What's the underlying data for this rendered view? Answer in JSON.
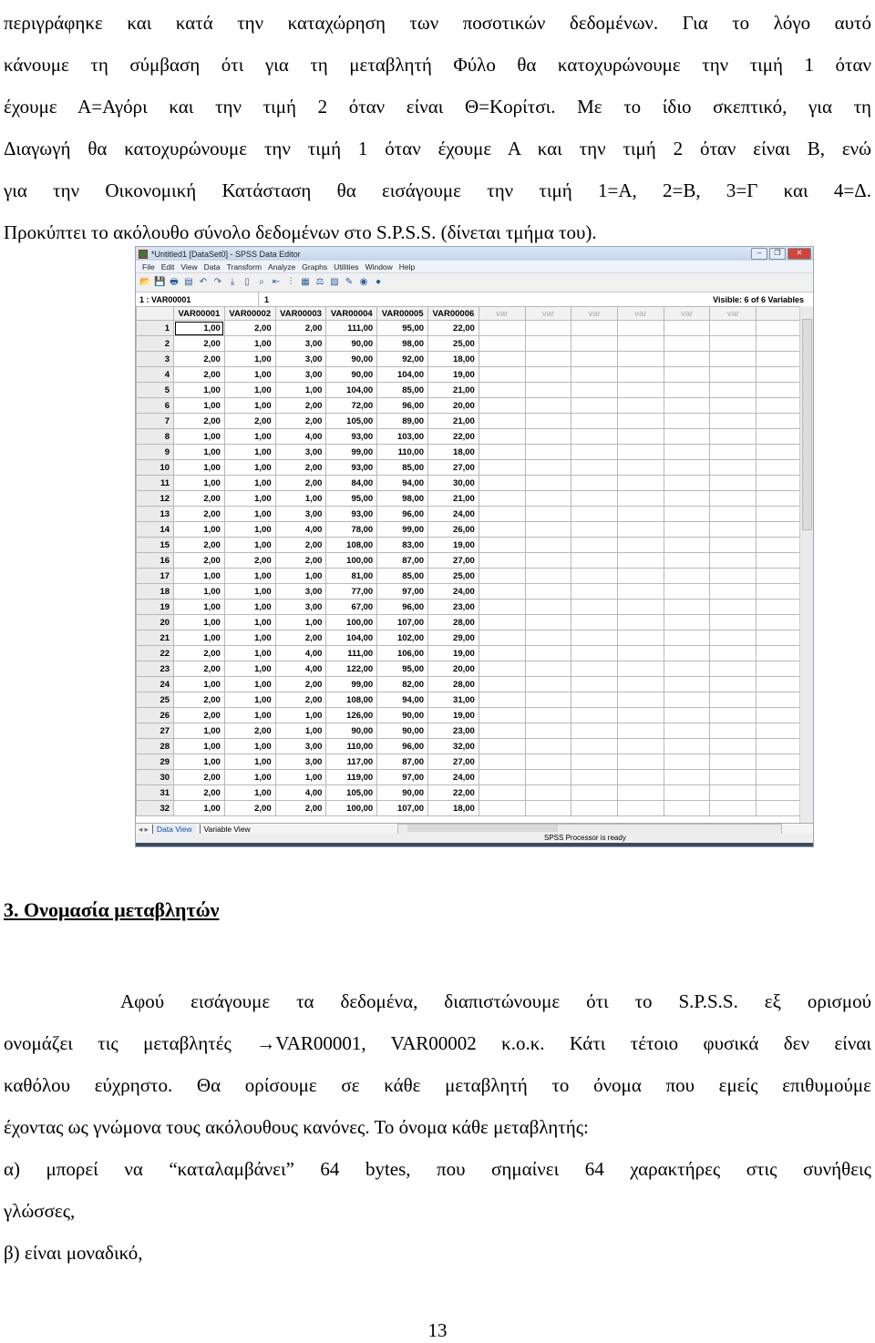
{
  "document": {
    "top_paragraph_lines": [
      "περιγράφηκε και κατά την καταχώρηση των ποσοτικών δεδομένων. Για το λόγο αυτό",
      "κάνουμε τη σύμβαση ότι για τη μεταβλητή Φύλο θα κατοχυρώνουμε την τιμή 1 όταν",
      "έχουμε Α=Αγόρι και την τιμή 2 όταν είναι Θ=Κορίτσι. Με το ίδιο σκεπτικό, για τη",
      "Διαγωγή θα κατοχυρώνουμε την τιμή 1 όταν έχουμε Α και την τιμή 2 όταν είναι Β, ενώ",
      "για την Οικονομική Κατάσταση θα εισάγουμε την τιμή 1=Α, 2=Β, 3=Γ και 4=Δ.",
      "Προκύπτει το ακόλουθο σύνολο  δεδομένων στο S.P.S.S. (δίνεται τμήμα του)."
    ],
    "heading": "3. Ονομασία μεταβλητών",
    "body_paragraph_lines": [
      "Αφού εισάγουμε τα δεδομένα, διαπιστώνουμε ότι το S.P.S.S. εξ ορισμού",
      "ονομάζει τις μεταβλητές →VAR00001, VAR00002 κ.ο.κ. Κάτι τέτοιο φυσικά δεν είναι",
      "καθόλου εύχρηστο. Θα ορίσουμε σε κάθε μεταβλητή το όνομα που εμείς επιθυμούμε",
      "έχοντας ως γνώμονα τους ακόλουθους κανόνες. Το όνομα κάθε μεταβλητής:",
      "α) μπορεί να “καταλαμβάνει” 64 bytes, που σημαίνει 64 χαρακτήρες στις συνήθεις",
      "γλώσσες,",
      "β) είναι μοναδικό,"
    ],
    "page_number": "13"
  },
  "spss": {
    "title": "*Untitled1 [DataSet0] - SPSS Data Editor",
    "window_buttons": {
      "minimize": "–",
      "restore": "❐",
      "close": "✕"
    },
    "menu": [
      "File",
      "Edit",
      "View",
      "Data",
      "Transform",
      "Analyze",
      "Graphs",
      "Utilities",
      "Window",
      "Help"
    ],
    "toolbar_icons": [
      "open-icon",
      "save-icon",
      "print-icon",
      "dialog-recall-icon",
      "undo-icon",
      "redo-icon",
      "goto-case-icon",
      "variables-icon",
      "find-icon",
      "insert-cases-icon",
      "insert-variable-icon",
      "split-file-icon",
      "weight-cases-icon",
      "select-cases-icon",
      "value-labels-icon",
      "use-sets-icon",
      "show-all-icon"
    ],
    "cell_reference": "1 : VAR00001",
    "cell_value": "1",
    "visible_text": "Visible: 6 of 6 Variables",
    "columns": [
      "VAR00001",
      "VAR00002",
      "VAR00003",
      "VAR00004",
      "VAR00005",
      "VAR00006"
    ],
    "empty_columns": [
      "var",
      "var",
      "var",
      "var",
      "var",
      "var"
    ],
    "rows": [
      [
        "1",
        "1,00",
        "2,00",
        "2,00",
        "111,00",
        "95,00",
        "22,00"
      ],
      [
        "2",
        "2,00",
        "1,00",
        "3,00",
        "90,00",
        "98,00",
        "25,00"
      ],
      [
        "3",
        "2,00",
        "1,00",
        "3,00",
        "90,00",
        "92,00",
        "18,00"
      ],
      [
        "4",
        "2,00",
        "1,00",
        "3,00",
        "90,00",
        "104,00",
        "19,00"
      ],
      [
        "5",
        "1,00",
        "1,00",
        "1,00",
        "104,00",
        "85,00",
        "21,00"
      ],
      [
        "6",
        "1,00",
        "1,00",
        "2,00",
        "72,00",
        "96,00",
        "20,00"
      ],
      [
        "7",
        "2,00",
        "2,00",
        "2,00",
        "105,00",
        "89,00",
        "21,00"
      ],
      [
        "8",
        "1,00",
        "1,00",
        "4,00",
        "93,00",
        "103,00",
        "22,00"
      ],
      [
        "9",
        "1,00",
        "1,00",
        "3,00",
        "99,00",
        "110,00",
        "18,00"
      ],
      [
        "10",
        "1,00",
        "1,00",
        "2,00",
        "93,00",
        "85,00",
        "27,00"
      ],
      [
        "11",
        "1,00",
        "1,00",
        "2,00",
        "84,00",
        "94,00",
        "30,00"
      ],
      [
        "12",
        "2,00",
        "1,00",
        "1,00",
        "95,00",
        "98,00",
        "21,00"
      ],
      [
        "13",
        "2,00",
        "1,00",
        "3,00",
        "93,00",
        "96,00",
        "24,00"
      ],
      [
        "14",
        "1,00",
        "1,00",
        "4,00",
        "78,00",
        "99,00",
        "26,00"
      ],
      [
        "15",
        "2,00",
        "1,00",
        "2,00",
        "108,00",
        "83,00",
        "19,00"
      ],
      [
        "16",
        "2,00",
        "2,00",
        "2,00",
        "100,00",
        "87,00",
        "27,00"
      ],
      [
        "17",
        "1,00",
        "1,00",
        "1,00",
        "81,00",
        "85,00",
        "25,00"
      ],
      [
        "18",
        "1,00",
        "1,00",
        "3,00",
        "77,00",
        "97,00",
        "24,00"
      ],
      [
        "19",
        "1,00",
        "1,00",
        "3,00",
        "67,00",
        "96,00",
        "23,00"
      ],
      [
        "20",
        "1,00",
        "1,00",
        "1,00",
        "100,00",
        "107,00",
        "28,00"
      ],
      [
        "21",
        "1,00",
        "1,00",
        "2,00",
        "104,00",
        "102,00",
        "29,00"
      ],
      [
        "22",
        "2,00",
        "1,00",
        "4,00",
        "111,00",
        "106,00",
        "19,00"
      ],
      [
        "23",
        "2,00",
        "1,00",
        "4,00",
        "122,00",
        "95,00",
        "20,00"
      ],
      [
        "24",
        "1,00",
        "1,00",
        "2,00",
        "99,00",
        "82,00",
        "28,00"
      ],
      [
        "25",
        "2,00",
        "1,00",
        "2,00",
        "108,00",
        "94,00",
        "31,00"
      ],
      [
        "26",
        "2,00",
        "1,00",
        "1,00",
        "126,00",
        "90,00",
        "19,00"
      ],
      [
        "27",
        "1,00",
        "2,00",
        "1,00",
        "90,00",
        "90,00",
        "23,00"
      ],
      [
        "28",
        "1,00",
        "1,00",
        "3,00",
        "110,00",
        "96,00",
        "32,00"
      ],
      [
        "29",
        "1,00",
        "1,00",
        "3,00",
        "117,00",
        "87,00",
        "27,00"
      ],
      [
        "30",
        "2,00",
        "1,00",
        "1,00",
        "119,00",
        "97,00",
        "24,00"
      ],
      [
        "31",
        "2,00",
        "1,00",
        "4,00",
        "105,00",
        "90,00",
        "22,00"
      ],
      [
        "32",
        "1,00",
        "2,00",
        "2,00",
        "100,00",
        "107,00",
        "18,00"
      ]
    ],
    "tabs": [
      "Data View",
      "Variable View"
    ],
    "active_tab": "Data View",
    "status": "SPSS Processor is ready"
  }
}
